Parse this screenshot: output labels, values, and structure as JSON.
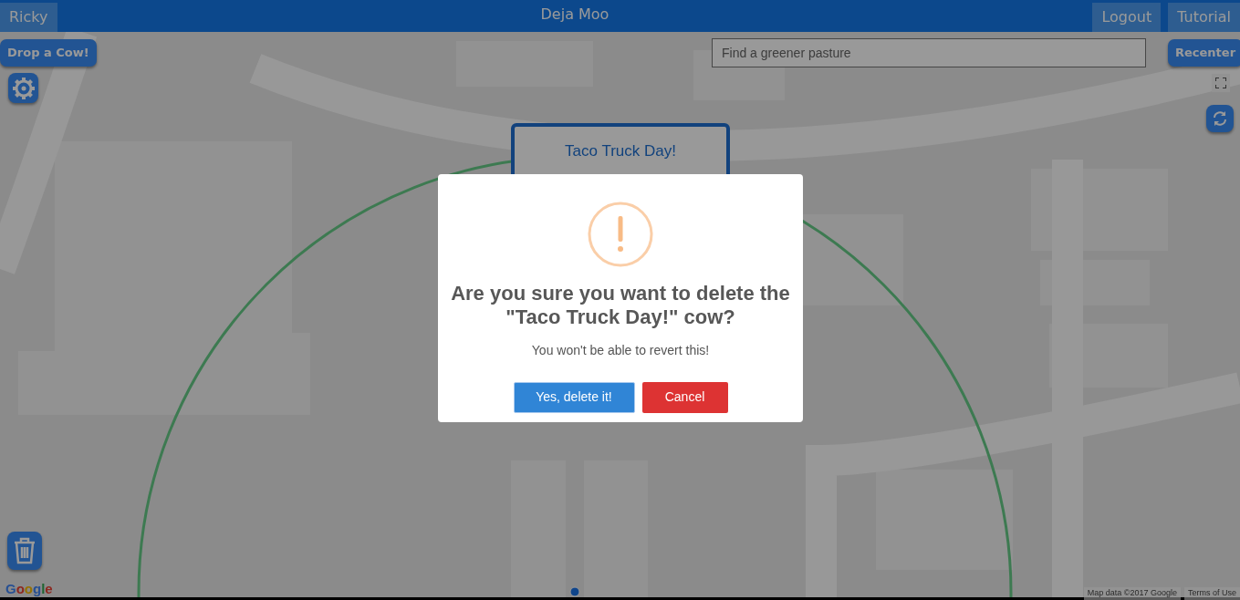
{
  "navbar": {
    "user_button": "Ricky",
    "title": "Deja Moo",
    "buttons": [
      "Logout",
      "Tutorial"
    ]
  },
  "map_controls": {
    "drop_button": "Drop a Cow!",
    "search": {
      "placeholder": "Find a greener pasture"
    },
    "recenter_button": "Recenter"
  },
  "marker_card": {
    "title": "Taco Truck Day!"
  },
  "attribution": {
    "logo": "Google",
    "map_data": "Map data ©2017 Google",
    "terms": "Terms of Use"
  },
  "dialog": {
    "title": "Are you sure you want to delete the \"Taco Truck Day!\" cow?",
    "text": "You won't be able to revert this!",
    "buttons": [
      {
        "label": "Yes, delete it!",
        "kind": "confirm"
      },
      {
        "label": "Cancel",
        "kind": "cancel"
      }
    ]
  }
}
